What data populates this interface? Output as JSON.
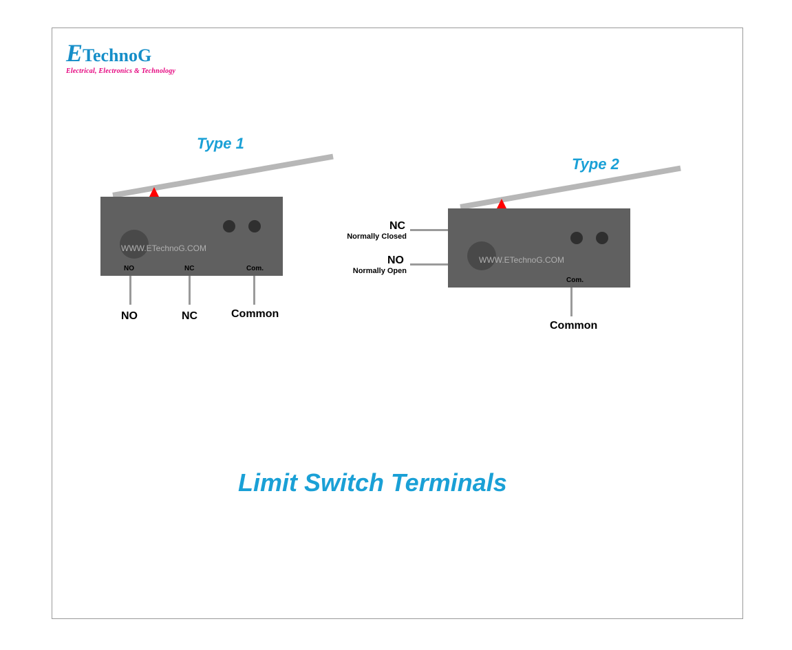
{
  "logo": {
    "brand_first": "E",
    "brand_rest": "TechnoG",
    "tag": "Electrical, Electronics & Technology"
  },
  "type1": {
    "title": "Type 1",
    "watermark": "WWW.ETechnoG.COM",
    "body_no": "NO",
    "body_nc": "NC",
    "body_com": "Com.",
    "labels": {
      "no": "NO",
      "nc": "NC",
      "common": "Common"
    }
  },
  "type2": {
    "title": "Type 2",
    "watermark": "WWW.ETechnoG.COM",
    "body_com": "Com.",
    "labels": {
      "nc": "NC",
      "nc_full": "Normally Closed",
      "no": "NO",
      "no_full": "Normally Open",
      "common": "Common"
    }
  },
  "main_title": "Limit Switch Terminals"
}
